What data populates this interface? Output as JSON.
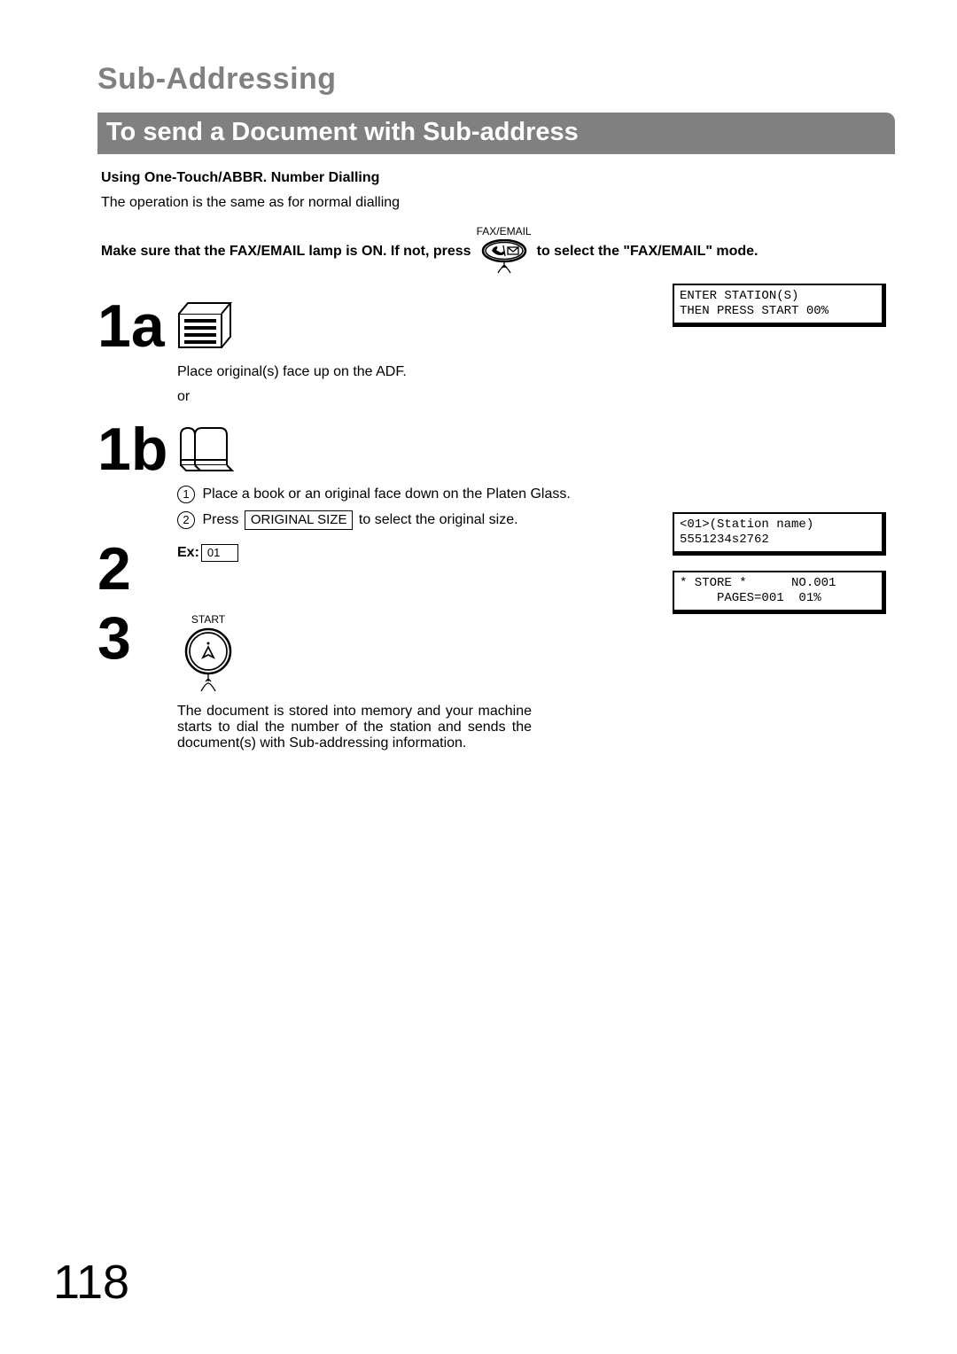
{
  "page_title": "Sub-Addressing",
  "section_bar": "To send a Document with Sub-address",
  "sub_heading": "Using One-Touch/ABBR. Number Dialling",
  "intro": "The operation is the same as for normal dialling",
  "instruction_pre": "Make sure that the FAX/EMAIL lamp is ON.  If not, press",
  "fax_email_label": "FAX/EMAIL",
  "instruction_post": "to select the \"FAX/EMAIL\" mode.",
  "step1a_num": "1a",
  "step1a_text": "Place original(s) face up on the ADF.",
  "or_text": "or",
  "step1b_num": "1b",
  "step1b_line1_num": "1",
  "step1b_line1": "Place a book or an original face down on the Platen Glass.",
  "step1b_line2_num": "2",
  "step1b_line2_pre": "Press",
  "original_size_btn": "ORIGINAL   SIZE",
  "step1b_line2_post": "to select the original size.",
  "step2_num": "2",
  "step2_ex": "Ex:",
  "step2_key": "01",
  "step3_num": "3",
  "start_label": "START",
  "step3_desc": "The document is stored into memory and your machine starts to dial the number of the station and sends the document(s) with Sub-addressing information.",
  "lcd1_line1": "ENTER STATION(S)",
  "lcd1_line2": "THEN PRESS START 00%",
  "lcd2_line1": "<01>(Station name)",
  "lcd2_line2": "5551234s2762",
  "lcd3_line1": "* STORE *      NO.001",
  "lcd3_line2": "     PAGES=001  01%",
  "page_number": "118"
}
